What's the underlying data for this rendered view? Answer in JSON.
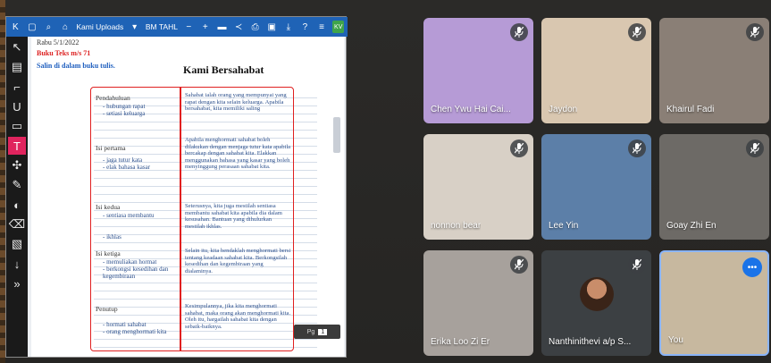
{
  "toolbar": {
    "menu_label": "Kami Uploads",
    "file_label": "BM TAHL",
    "badge": "KV"
  },
  "document": {
    "header_line1": "Rabu 5/1/2022",
    "header_line2": "Buku Teks m/s 71",
    "header_line3": "Salin di dalam buku tulis.",
    "title": "Kami Bersahabat",
    "sections": [
      {
        "heading": "Pendahuluan",
        "points": "- hubungan rapat\n- setiasi keluarga",
        "text": "Sahabat ialah orang yang mempunyai yang rapat dengan kita selain keluarga. Apabila bersahabat, kita memiliki saling"
      },
      {
        "heading": "Isi pertama",
        "points": "- jaga tutur kata\n- elak bahasa kasar",
        "text": "Apabila menghormati sahabat boleh dilakukan dengan menjaga tutur kata apabila bercakap dengan sahabat kita. Elakkan menggunakan bahasa yang kasar yang boleh menyinggung perasaan sahabat kita."
      },
      {
        "heading": "Isi kedua",
        "points": "- sentiasa membantu\n\n\n- ikhlas",
        "text": "Seterusnya, kita juga mestilah sentiasa membantu sahabat kita apabila dia dalam kesusahan. Bantuan yang dihulurkan mestilah ikhlas."
      },
      {
        "heading": "Isi ketiga",
        "points": "- memuliakan hormat\n- berkongsi kesedihan dan\n  kegembiraan",
        "text": "Selain itu, kita hendaklah menghormati bersi tentang keadaan sahabat kita. Berkongsilah kesedihan dan kegembiraan yang dialaminya."
      },
      {
        "heading": "Penutup",
        "points": "- hormati sahabat\n- orang menghormati kita",
        "text": "Kesimpulannya, jika kita menghormati sahabat, maka orang akan menghormati kita. Oleh itu, hargailah sahabat kita dengan sebaik-baiknya."
      }
    ],
    "page_label": "Pg",
    "page_number": "1"
  },
  "participants": [
    {
      "name": "Chen Ywu Hai Cai...",
      "bg": "#b69bd6"
    },
    {
      "name": "Jaydon",
      "bg": "#d9c7b0"
    },
    {
      "name": "Khairul Fadi",
      "bg": "#8a7f76"
    },
    {
      "name": "nonnon bear",
      "bg": "#d8d0c6"
    },
    {
      "name": "Lee Yin",
      "bg": "#5c7fa8"
    },
    {
      "name": "Goay Zhi En",
      "bg": "#6d6a66"
    },
    {
      "name": "Erika Loo Zi Er",
      "bg": "#a7a19c"
    },
    {
      "name": "Nanthinithevi a/p S...",
      "bg": "#3c4043"
    },
    {
      "name": "You",
      "bg": "#c7b89f"
    }
  ],
  "colors": {
    "toolbar": "#1f63b6",
    "active_tool": "#e0245e",
    "annotation": "#e02020",
    "you_border": "#8ab4f8"
  }
}
